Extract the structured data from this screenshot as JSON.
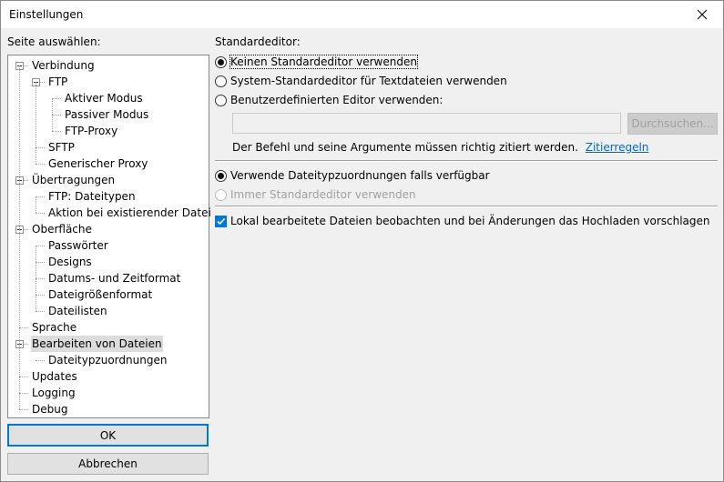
{
  "window": {
    "title": "Einstellungen",
    "close_icon": "close-icon"
  },
  "left_panel": {
    "label": "Seite auswählen:"
  },
  "tree": [
    {
      "label": "Verbindung",
      "level": 0,
      "expanded": true
    },
    {
      "label": "FTP",
      "level": 1,
      "expanded": true
    },
    {
      "label": "Aktiver Modus",
      "level": 2
    },
    {
      "label": "Passiver Modus",
      "level": 2
    },
    {
      "label": "FTP-Proxy",
      "level": 2
    },
    {
      "label": "SFTP",
      "level": 1
    },
    {
      "label": "Generischer Proxy",
      "level": 1
    },
    {
      "label": "Übertragungen",
      "level": 0,
      "expanded": true
    },
    {
      "label": "FTP: Dateitypen",
      "level": 1
    },
    {
      "label": "Aktion bei existierender Datei",
      "level": 1
    },
    {
      "label": "Oberfläche",
      "level": 0,
      "expanded": true
    },
    {
      "label": "Passwörter",
      "level": 1
    },
    {
      "label": "Designs",
      "level": 1
    },
    {
      "label": "Datums- und Zeitformat",
      "level": 1
    },
    {
      "label": "Dateigrößenformat",
      "level": 1
    },
    {
      "label": "Dateilisten",
      "level": 1
    },
    {
      "label": "Sprache",
      "level": 0
    },
    {
      "label": "Bearbeiten von Dateien",
      "level": 0,
      "expanded": true,
      "selected": true
    },
    {
      "label": "Dateitypzuordnungen",
      "level": 1
    },
    {
      "label": "Updates",
      "level": 0
    },
    {
      "label": "Logging",
      "level": 0
    },
    {
      "label": "Debug",
      "level": 0
    }
  ],
  "buttons": {
    "ok": "OK",
    "cancel": "Abbrechen",
    "browse": "Durchsuchen..."
  },
  "settings": {
    "section_label": "Standardeditor:",
    "radio_none": "Keinen Standardeditor verwenden",
    "radio_system": "System-Standardeditor für Textdateien verwenden",
    "radio_custom": "Benutzerdefinierten Editor verwenden:",
    "custom_editor_value": "",
    "hint": "Der Befehl und seine Argumente müssen richtig zitiert werden.",
    "hint_link": "Zitierregeln",
    "radio_filetype": "Verwende Dateitypzuordnungen falls verfügbar",
    "radio_always": "Immer Standardeditor verwenden",
    "watch_checkbox": "Lokal bearbeitete Dateien beobachten und bei Änderungen das Hochladen vorschlagen",
    "watch_checked": true,
    "selected_editor": "none",
    "selected_mode": "filetype"
  },
  "colors": {
    "accent": "#0078d7",
    "link": "#0066cc",
    "selection": "#dcdcdc"
  }
}
